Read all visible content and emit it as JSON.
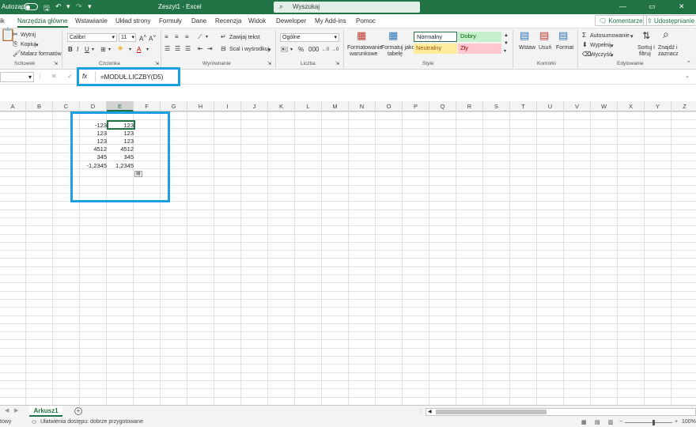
{
  "titlebar": {
    "autosave_label": "Autozapis",
    "document_title": "Zeszyt1 - Excel",
    "search_placeholder": "Wyszukaj"
  },
  "tabs": [
    "ik",
    "Narzędzia główne",
    "Wstawianie",
    "Układ strony",
    "Formuły",
    "Dane",
    "Recenzja",
    "Widok",
    "Deweloper",
    "My Add-ins",
    "Pomoc"
  ],
  "active_tab": "Narzędzia główne",
  "share": {
    "comments": "Komentarze",
    "share": "Udostępnianie"
  },
  "ribbon": {
    "clipboard": {
      "cut": "Wytnij",
      "copy": "Kopiuj",
      "painter": "Malarz formatów",
      "label": "Schowek"
    },
    "font": {
      "name": "Calibri",
      "size": "11",
      "label": "Czcionka"
    },
    "alignment": {
      "wrap": "Zawijaj tekst",
      "merge": "Scal i wyśrodkuj",
      "label": "Wyrównanie"
    },
    "number": {
      "format": "Ogólne",
      "label": "Liczba"
    },
    "styles": {
      "cond_format_1": "Formatowanie",
      "cond_format_2": "warunkowe",
      "table_format_1": "Formatuj jako",
      "table_format_2": "tabelę",
      "normal": "Normalny",
      "good": "Dobry",
      "neutral": "Neutralny",
      "bad": "Zły",
      "label": "Style"
    },
    "cells": {
      "insert": "Wstaw",
      "delete": "Usuń",
      "format": "Format",
      "label": "Komórki"
    },
    "editing": {
      "autosum": "Autosumowanie",
      "fill": "Wypełnij",
      "clear": "Wyczyść",
      "sort_1": "Sortuj i",
      "sort_2": "filtruj",
      "find_1": "Znajdź i",
      "find_2": "zaznacz",
      "label": "Edytowanie"
    }
  },
  "formula_bar": {
    "fx": "fx",
    "formula": "=MODUŁ.LICZBY(D5)"
  },
  "columns": [
    "A",
    "B",
    "C",
    "D",
    "E",
    "F",
    "G",
    "H",
    "I",
    "J",
    "K",
    "L",
    "M",
    "N",
    "O",
    "P",
    "Q",
    "R",
    "S",
    "T",
    "U",
    "V",
    "W",
    "X",
    "Y",
    "Z"
  ],
  "selected_column": "E",
  "cells": {
    "D": [
      "-123",
      "123",
      "123",
      "4512",
      "345",
      "-1,2345"
    ],
    "E": [
      "123",
      "123",
      "123",
      "4512",
      "345",
      "1,2345"
    ]
  },
  "sheet": {
    "tab": "Arkusz1",
    "add": "+"
  },
  "status": {
    "left": "towy",
    "accessibility": "Ułatwienia dostępu: dobrze przygotowane",
    "zoom": "100%"
  },
  "colors": {
    "accent": "#217346",
    "highlight": "#1ba1e2",
    "good_bg": "#c6efce",
    "neutral_bg": "#ffeb9c",
    "bad_bg": "#ffc7ce"
  }
}
